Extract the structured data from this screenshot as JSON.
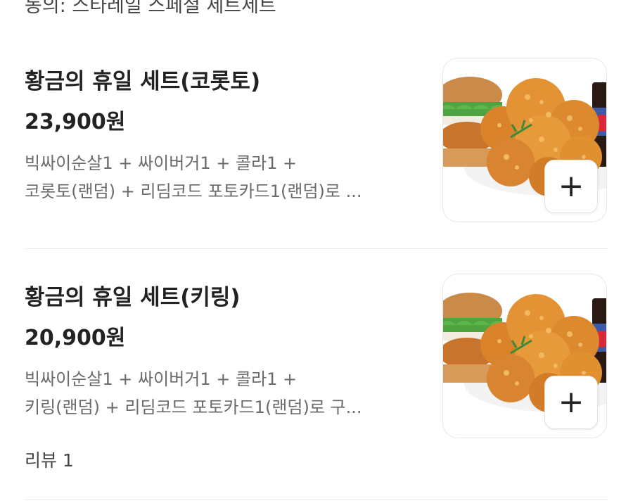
{
  "top_fragment": "동의: 스타레일 스페셜 세트세트",
  "items": [
    {
      "name": "황금의 휴일 세트(코롯토)",
      "price": "23,900원",
      "desc_line1": "빅싸이순살1 + 싸이버거1 + 콜라1 +",
      "desc_line2": "코롯토(랜덤) + 리딤코드 포토카드1(랜덤)로 ...",
      "add_label": "+"
    },
    {
      "name": "황금의 휴일 세트(키링)",
      "price": "20,900원",
      "desc_line1": "빅싸이순살1 + 싸이버거1 + 콜라1 +",
      "desc_line2": "키링(랜덤) + 리딤코드 포토카드1(랜덤)로 구...",
      "review": "리뷰 1",
      "add_label": "+"
    }
  ],
  "icons": {
    "add": "plus-icon",
    "thumbnail": "chicken-set-photo"
  },
  "colors": {
    "text_primary": "#222222",
    "text_secondary": "#6a6a6a",
    "divider": "#ececec",
    "fried_chicken": "#e08a2a"
  }
}
